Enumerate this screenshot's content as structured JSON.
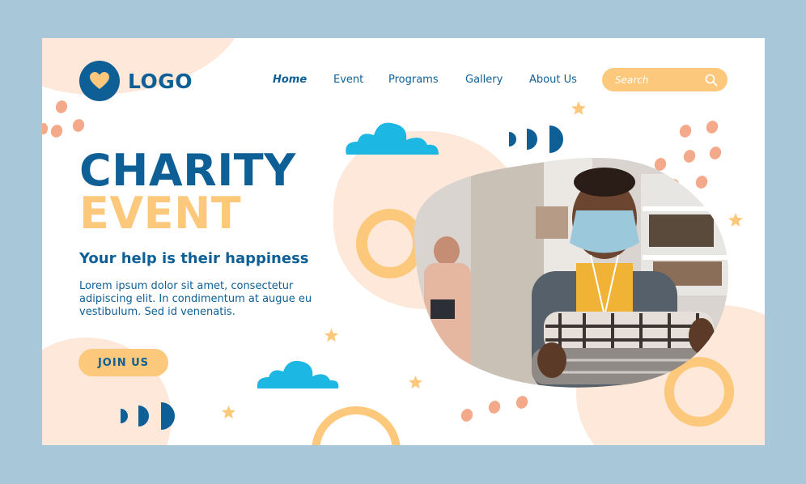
{
  "header": {
    "logo_text": "LOGO",
    "nav": [
      {
        "label": "Home",
        "active": true
      },
      {
        "label": "Event",
        "active": false
      },
      {
        "label": "Programs",
        "active": false
      },
      {
        "label": "Gallery",
        "active": false
      },
      {
        "label": "About Us",
        "active": false
      }
    ],
    "search": {
      "placeholder": "Search",
      "value": ""
    }
  },
  "hero": {
    "title_line1": "CHARITY",
    "title_line2": "EVENT",
    "tagline": "Your help is their happiness",
    "body": "Lorem ipsum dolor sit amet, consectetur adipiscing elit. In condimentum at augue eu vestibulum. Sed id venenatis.",
    "cta_label": "JOIN US"
  },
  "colors": {
    "background": "#a8c8da",
    "primary_blue": "#0e5f96",
    "accent_yellow": "#fcc97c",
    "peach": "#fde8da",
    "cloud_cyan": "#1cb8e3",
    "dot_salmon": "#f4a98a"
  },
  "icons": {
    "logo": "heart-icon",
    "search": "magnifier-icon",
    "decor": [
      "cloud-icon",
      "star-icon",
      "ring-icon",
      "dot-pattern",
      "half-circle-pattern"
    ]
  }
}
